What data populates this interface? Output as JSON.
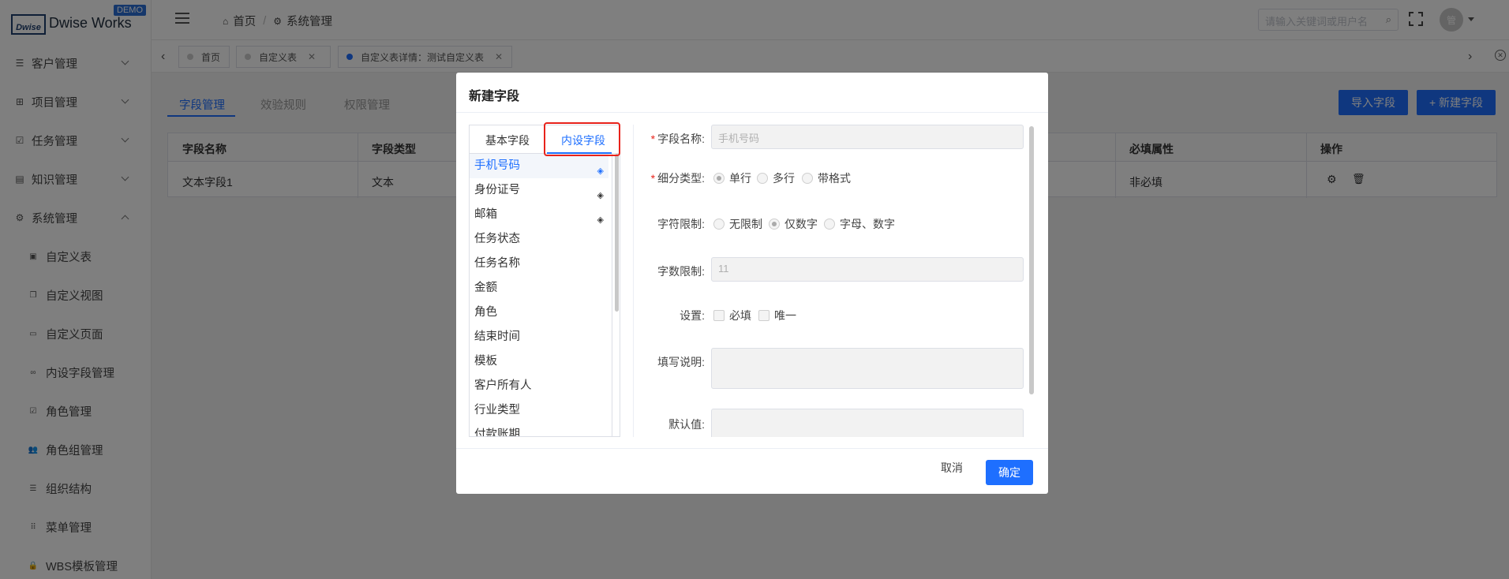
{
  "brand": {
    "logo_text": "Dwise",
    "name": "Dwise Works",
    "badge": "DEMO"
  },
  "sidebar": {
    "items": [
      {
        "label": "客户管理",
        "icon": "list-icon",
        "expanded": false
      },
      {
        "label": "项目管理",
        "icon": "grid-icon",
        "expanded": false
      },
      {
        "label": "任务管理",
        "icon": "calendar-check-icon",
        "expanded": false
      },
      {
        "label": "知识管理",
        "icon": "book-icon",
        "expanded": false
      },
      {
        "label": "系统管理",
        "icon": "gear-icon",
        "expanded": true
      }
    ],
    "sub_items": [
      {
        "label": "自定义表",
        "icon": "document-icon"
      },
      {
        "label": "自定义视图",
        "icon": "copy-icon"
      },
      {
        "label": "自定义页面",
        "icon": "window-icon"
      },
      {
        "label": "内设字段管理",
        "icon": "link-icon"
      },
      {
        "label": "角色管理",
        "icon": "check-square-icon"
      },
      {
        "label": "角色组管理",
        "icon": "users-icon"
      },
      {
        "label": "组织结构",
        "icon": "list-icon"
      },
      {
        "label": "菜单管理",
        "icon": "dots-grid-icon"
      },
      {
        "label": "WBS模板管理",
        "icon": "lock-icon"
      }
    ]
  },
  "header": {
    "breadcrumb": [
      "首页",
      "系统管理"
    ],
    "search_placeholder": "请输入关键词或用户名",
    "avatar_text": "管"
  },
  "tabs": [
    {
      "label": "首页",
      "active": false,
      "closable": false
    },
    {
      "label": "自定义表",
      "active": false,
      "closable": true
    },
    {
      "label": "自定义表详情：测试自定义表",
      "active": true,
      "closable": true
    }
  ],
  "page": {
    "inner_tabs": [
      "字段管理",
      "效验规则",
      "权限管理"
    ],
    "active_inner_tab": "字段管理",
    "import_button": "导入字段",
    "new_button": "+ 新建字段",
    "table": {
      "columns": [
        "字段名称",
        "字段类型",
        "必填属性",
        "操作"
      ],
      "rows": [
        {
          "name": "文本字段1",
          "type": "文本",
          "required": "非必填"
        }
      ]
    }
  },
  "modal": {
    "title": "新建字段",
    "field_tabs": [
      "基本字段",
      "内设字段"
    ],
    "active_field_tab": "内设字段",
    "field_list": [
      {
        "label": "手机号码",
        "stacked": true,
        "active": true
      },
      {
        "label": "身份证号",
        "stacked": true,
        "active": false
      },
      {
        "label": "邮箱",
        "stacked": true,
        "active": false
      },
      {
        "label": "任务状态",
        "stacked": false,
        "active": false
      },
      {
        "label": "任务名称",
        "stacked": false,
        "active": false
      },
      {
        "label": "金额",
        "stacked": false,
        "active": false
      },
      {
        "label": "角色",
        "stacked": false,
        "active": false
      },
      {
        "label": "结束时间",
        "stacked": false,
        "active": false
      },
      {
        "label": "模板",
        "stacked": false,
        "active": false
      },
      {
        "label": "客户所有人",
        "stacked": false,
        "active": false
      },
      {
        "label": "行业类型",
        "stacked": false,
        "active": false
      },
      {
        "label": "付款账期",
        "stacked": false,
        "active": false
      }
    ],
    "form": {
      "name_label": "字段名称:",
      "name_placeholder": "手机号码",
      "subtype_label": "细分类型:",
      "subtype_options": [
        "单行",
        "多行",
        "带格式"
      ],
      "subtype_selected": "单行",
      "charlimit_label": "字符限制:",
      "charlimit_options": [
        "无限制",
        "仅数字",
        "字母、数字"
      ],
      "charlimit_selected": "仅数字",
      "length_label": "字数限制:",
      "length_value": "11",
      "settings_label": "设置:",
      "settings_options": [
        "必填",
        "唯一"
      ],
      "description_label": "填写说明:",
      "default_label": "默认值:"
    },
    "cancel_button": "取消",
    "ok_button": "确定"
  },
  "colors": {
    "primary": "#1e6fff",
    "highlight": "#e8231b"
  }
}
